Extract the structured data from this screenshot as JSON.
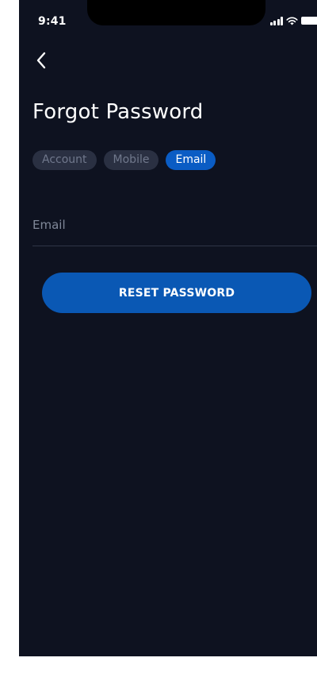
{
  "status_bar": {
    "time": "9:41"
  },
  "header": {
    "back_icon": "chevron-left-icon",
    "title": "Forgot Password"
  },
  "tabs": [
    {
      "label": "Account",
      "active": false
    },
    {
      "label": "Mobile",
      "active": false
    },
    {
      "label": "Email",
      "active": true
    }
  ],
  "form": {
    "email_placeholder": "Email",
    "email_value": ""
  },
  "actions": {
    "reset_label": "RESET PASSWORD"
  },
  "colors": {
    "background": "#0e1220",
    "accent": "#0a58b4",
    "tab_inactive_bg": "#2a3042",
    "tab_inactive_text": "#70788c"
  }
}
